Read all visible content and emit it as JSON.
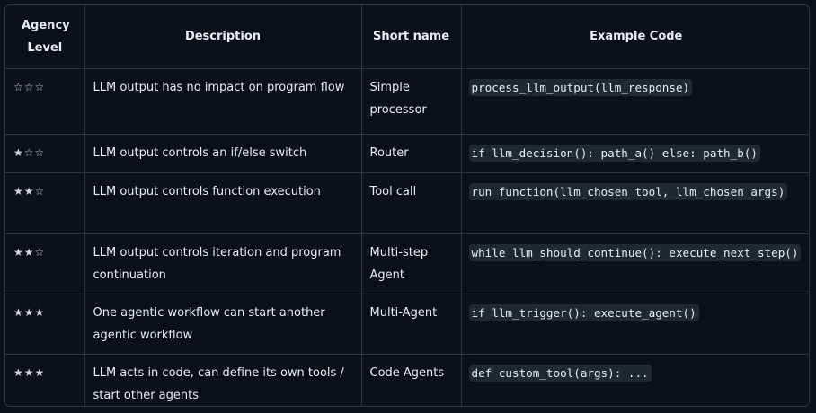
{
  "table": {
    "headers": {
      "agency_level": "Agency Level",
      "description": "Description",
      "short_name": "Short name",
      "example_code": "Example Code"
    },
    "rows": [
      {
        "stars": "☆☆☆",
        "description": "LLM output has no impact on program flow",
        "short_name": "Simple processor",
        "code": "process_llm_output(llm_response)"
      },
      {
        "stars": "★☆☆",
        "description": "LLM output controls an if/else switch",
        "short_name": "Router",
        "code": "if llm_decision(): path_a() else: path_b()"
      },
      {
        "stars": "★★☆",
        "description": "LLM output controls function execution",
        "short_name": "Tool call",
        "code": "run_function(llm_chosen_tool, llm_chosen_args)"
      },
      {
        "stars": "★★☆",
        "description": "LLM output controls iteration and program continuation",
        "short_name": "Multi-step Agent",
        "code": "while llm_should_continue(): execute_next_step()"
      },
      {
        "stars": "★★★",
        "description": "One agentic workflow can start another agentic workflow",
        "short_name": "Multi-Agent",
        "code": "if llm_trigger(): execute_agent()"
      },
      {
        "stars": "★★★",
        "description": "LLM acts in code, can define its own tools / start other agents",
        "short_name": "Code Agents",
        "code": "def custom_tool(args): ..."
      }
    ]
  }
}
